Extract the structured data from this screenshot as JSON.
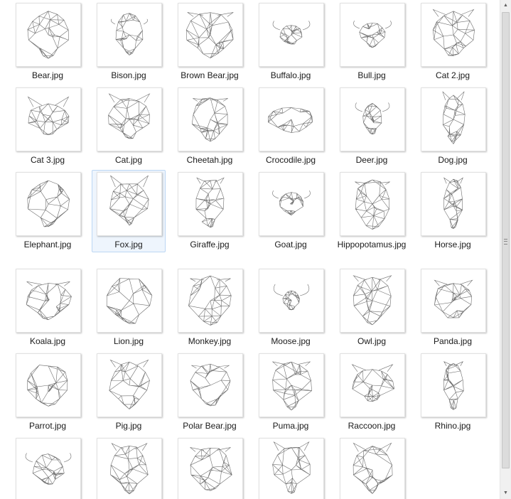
{
  "files": [
    {
      "name": "Bear.jpg",
      "icon": "bear-head-icon"
    },
    {
      "name": "Bison.jpg",
      "icon": "bison-head-icon"
    },
    {
      "name": "Brown Bear.jpg",
      "icon": "brown-bear-head-icon"
    },
    {
      "name": "Buffalo.jpg",
      "icon": "buffalo-head-icon"
    },
    {
      "name": "Bull.jpg",
      "icon": "bull-head-icon"
    },
    {
      "name": "Cat 2.jpg",
      "icon": "cat-head-icon"
    },
    {
      "name": "Cat 3.jpg",
      "icon": "cat-head-icon"
    },
    {
      "name": "Cat.jpg",
      "icon": "cat-head-icon"
    },
    {
      "name": "Cheetah.jpg",
      "icon": "cheetah-head-icon"
    },
    {
      "name": "Crocodile.jpg",
      "icon": "crocodile-head-icon"
    },
    {
      "name": "Deer.jpg",
      "icon": "deer-head-icon"
    },
    {
      "name": "Dog.jpg",
      "icon": "dog-head-icon"
    },
    {
      "name": "Elephant.jpg",
      "icon": "elephant-head-icon"
    },
    {
      "name": "Fox.jpg",
      "icon": "fox-head-icon",
      "selected": true
    },
    {
      "name": "Giraffe.jpg",
      "icon": "giraffe-head-icon"
    },
    {
      "name": "Goat.jpg",
      "icon": "goat-head-icon"
    },
    {
      "name": "Hippopotamus.jpg",
      "icon": "hippopotamus-head-icon"
    },
    {
      "name": "Horse.jpg",
      "icon": "horse-head-icon"
    },
    {
      "name": "Koala.jpg",
      "icon": "koala-head-icon"
    },
    {
      "name": "Lion.jpg",
      "icon": "lion-head-icon"
    },
    {
      "name": "Monkey.jpg",
      "icon": "monkey-head-icon"
    },
    {
      "name": "Moose.jpg",
      "icon": "moose-head-icon"
    },
    {
      "name": "Owl.jpg",
      "icon": "owl-head-icon"
    },
    {
      "name": "Panda.jpg",
      "icon": "panda-head-icon"
    },
    {
      "name": "Parrot.jpg",
      "icon": "parrot-head-icon"
    },
    {
      "name": "Pig.jpg",
      "icon": "pig-head-icon"
    },
    {
      "name": "Polar Bear.jpg",
      "icon": "polar-bear-head-icon"
    },
    {
      "name": "Puma.jpg",
      "icon": "puma-head-icon"
    },
    {
      "name": "Raccoon.jpg",
      "icon": "raccoon-head-icon"
    },
    {
      "name": "Rhino.jpg",
      "icon": "rhino-head-icon"
    },
    {
      "name": "",
      "icon": "ram-head-icon"
    },
    {
      "name": "",
      "icon": "squirrel-head-icon"
    },
    {
      "name": "",
      "icon": "tiger-head-icon"
    },
    {
      "name": "",
      "icon": "wolf-head-icon"
    },
    {
      "name": "",
      "icon": "wolf-head-icon"
    }
  ],
  "colors": {
    "selection_bg": "#eef5fd",
    "selection_border": "#bcd6f3",
    "line_art": "#6f6f6f",
    "scrollbar_bg": "#f0f0f0"
  },
  "scrollbar": {
    "up_icon": "scroll-up-arrow-icon",
    "down_icon": "scroll-down-arrow-icon"
  }
}
